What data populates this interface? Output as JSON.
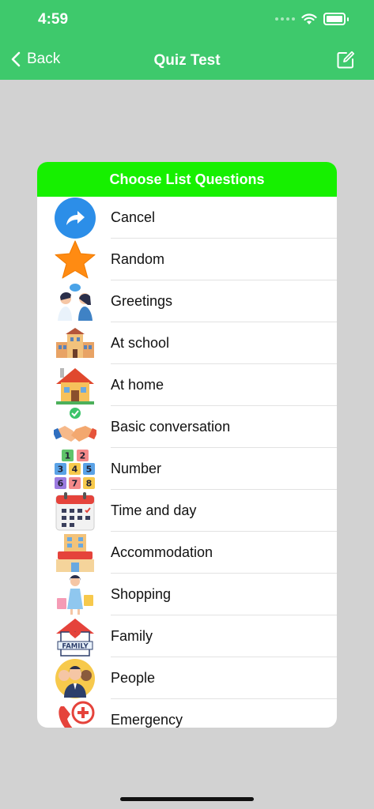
{
  "status": {
    "time": "4:59"
  },
  "nav": {
    "back_label": "Back",
    "title": "Quiz Test"
  },
  "panel": {
    "header": "Choose List Questions",
    "items": [
      {
        "label": "Cancel",
        "icon": "share-arrow-icon"
      },
      {
        "label": "Random",
        "icon": "star-icon"
      },
      {
        "label": "Greetings",
        "icon": "two-people-chatting-icon"
      },
      {
        "label": "At school",
        "icon": "school-building-icon"
      },
      {
        "label": "At home",
        "icon": "house-icon"
      },
      {
        "label": "Basic conversation",
        "icon": "handshake-icon"
      },
      {
        "label": "Number",
        "icon": "number-blocks-icon"
      },
      {
        "label": "Time and day",
        "icon": "calendar-icon"
      },
      {
        "label": "Accommodation",
        "icon": "hotel-icon"
      },
      {
        "label": "Shopping",
        "icon": "shopping-woman-icon"
      },
      {
        "label": "Family",
        "icon": "family-house-icon"
      },
      {
        "label": "People",
        "icon": "people-group-icon"
      },
      {
        "label": "Emergency",
        "icon": "emergency-phone-icon"
      }
    ]
  },
  "colors": {
    "nav": "#3ec96c",
    "header": "#16f000",
    "background": "#d2d2d2"
  }
}
